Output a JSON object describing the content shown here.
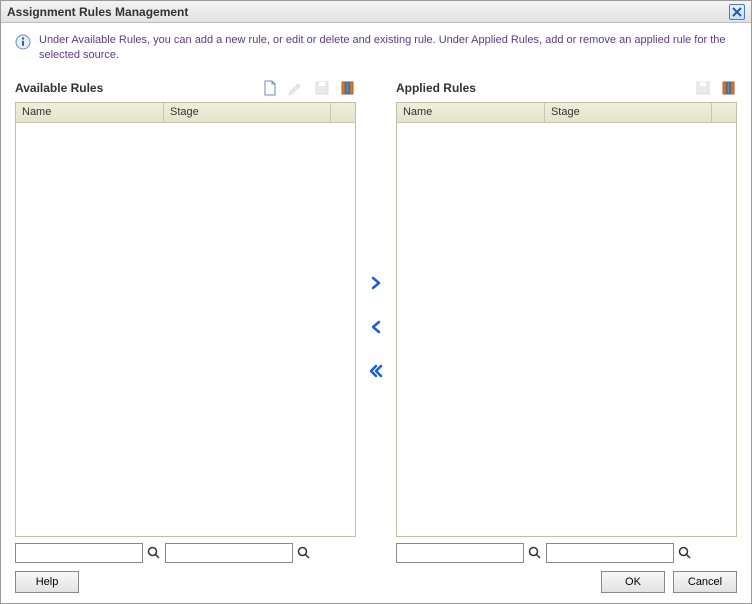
{
  "dialog": {
    "title": "Assignment Rules Management"
  },
  "info": {
    "text": "Under Available Rules, you can add a new rule, or edit or delete and existing rule. Under Applied Rules, add or remove an applied rule for the selected source."
  },
  "available": {
    "title": "Available Rules",
    "columns": {
      "name": "Name",
      "stage": "Stage"
    }
  },
  "applied": {
    "title": "Applied Rules",
    "columns": {
      "name": "Name",
      "stage": "Stage"
    }
  },
  "buttons": {
    "help": "Help",
    "ok": "OK",
    "cancel": "Cancel"
  }
}
